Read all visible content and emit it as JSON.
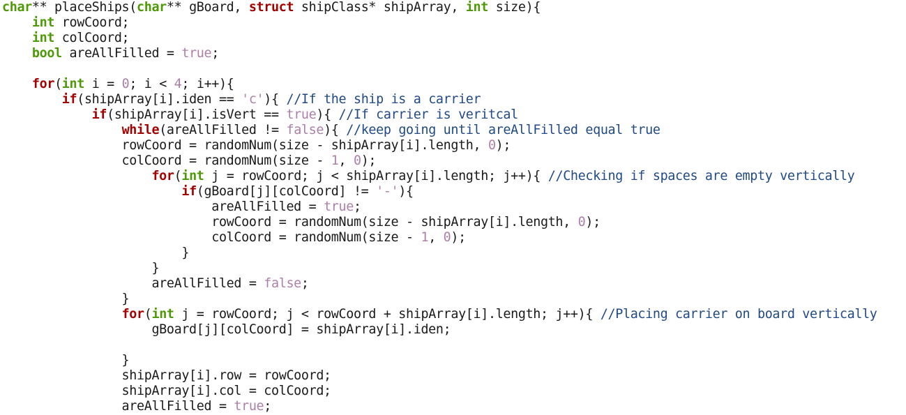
{
  "editor": {
    "lines": [
      [
        {
          "t": "type",
          "v": "char"
        },
        {
          "t": "plain",
          "v": "** placeShips("
        },
        {
          "t": "type",
          "v": "char"
        },
        {
          "t": "plain",
          "v": "** gBoard, "
        },
        {
          "t": "kw",
          "v": "struct"
        },
        {
          "t": "plain",
          "v": " shipClass* shipArray, "
        },
        {
          "t": "type",
          "v": "int"
        },
        {
          "t": "plain",
          "v": " size){"
        }
      ],
      [
        {
          "t": "plain",
          "v": "    "
        },
        {
          "t": "type",
          "v": "int"
        },
        {
          "t": "plain",
          "v": " rowCoord;"
        }
      ],
      [
        {
          "t": "plain",
          "v": "    "
        },
        {
          "t": "type",
          "v": "int"
        },
        {
          "t": "plain",
          "v": " colCoord;"
        }
      ],
      [
        {
          "t": "plain",
          "v": "    "
        },
        {
          "t": "type",
          "v": "bool"
        },
        {
          "t": "plain",
          "v": " areAllFilled = "
        },
        {
          "t": "lit",
          "v": "true"
        },
        {
          "t": "plain",
          "v": ";"
        }
      ],
      [],
      [
        {
          "t": "plain",
          "v": "    "
        },
        {
          "t": "kw",
          "v": "for"
        },
        {
          "t": "plain",
          "v": "("
        },
        {
          "t": "type",
          "v": "int"
        },
        {
          "t": "plain",
          "v": " i = "
        },
        {
          "t": "lit",
          "v": "0"
        },
        {
          "t": "plain",
          "v": "; i < "
        },
        {
          "t": "lit",
          "v": "4"
        },
        {
          "t": "plain",
          "v": "; i++){"
        }
      ],
      [
        {
          "t": "plain",
          "v": "        "
        },
        {
          "t": "kw",
          "v": "if"
        },
        {
          "t": "plain",
          "v": "(shipArray[i].iden == "
        },
        {
          "t": "lit",
          "v": "'c'"
        },
        {
          "t": "plain",
          "v": "){ "
        },
        {
          "t": "comment",
          "v": "//If the ship is a carrier"
        }
      ],
      [
        {
          "t": "plain",
          "v": "            "
        },
        {
          "t": "kw",
          "v": "if"
        },
        {
          "t": "plain",
          "v": "(shipArray[i].isVert == "
        },
        {
          "t": "lit",
          "v": "true"
        },
        {
          "t": "plain",
          "v": "){ "
        },
        {
          "t": "comment",
          "v": "//If carrier is veritcal"
        }
      ],
      [
        {
          "t": "plain",
          "v": "                "
        },
        {
          "t": "kw",
          "v": "while"
        },
        {
          "t": "plain",
          "v": "(areAllFilled != "
        },
        {
          "t": "lit",
          "v": "false"
        },
        {
          "t": "plain",
          "v": "){ "
        },
        {
          "t": "comment",
          "v": "//keep going until areAllFilled equal true"
        }
      ],
      [
        {
          "t": "plain",
          "v": "                rowCoord = randomNum(size - shipArray[i].length, "
        },
        {
          "t": "lit",
          "v": "0"
        },
        {
          "t": "plain",
          "v": ");"
        }
      ],
      [
        {
          "t": "plain",
          "v": "                colCoord = randomNum(size - "
        },
        {
          "t": "lit",
          "v": "1"
        },
        {
          "t": "plain",
          "v": ", "
        },
        {
          "t": "lit",
          "v": "0"
        },
        {
          "t": "plain",
          "v": ");"
        }
      ],
      [
        {
          "t": "plain",
          "v": "                    "
        },
        {
          "t": "kw",
          "v": "for"
        },
        {
          "t": "plain",
          "v": "("
        },
        {
          "t": "type",
          "v": "int"
        },
        {
          "t": "plain",
          "v": " j = rowCoord; j < shipArray[i].length; j++){ "
        },
        {
          "t": "comment",
          "v": "//Checking if spaces are empty vertically"
        }
      ],
      [
        {
          "t": "plain",
          "v": "                        "
        },
        {
          "t": "kw",
          "v": "if"
        },
        {
          "t": "plain",
          "v": "(gBoard[j][colCoord] != "
        },
        {
          "t": "lit",
          "v": "'-'"
        },
        {
          "t": "plain",
          "v": "){"
        }
      ],
      [
        {
          "t": "plain",
          "v": "                            areAllFilled = "
        },
        {
          "t": "lit",
          "v": "true"
        },
        {
          "t": "plain",
          "v": ";"
        }
      ],
      [
        {
          "t": "plain",
          "v": "                            rowCoord = randomNum(size - shipArray[i].length, "
        },
        {
          "t": "lit",
          "v": "0"
        },
        {
          "t": "plain",
          "v": ");"
        }
      ],
      [
        {
          "t": "plain",
          "v": "                            colCoord = randomNum(size - "
        },
        {
          "t": "lit",
          "v": "1"
        },
        {
          "t": "plain",
          "v": ", "
        },
        {
          "t": "lit",
          "v": "0"
        },
        {
          "t": "plain",
          "v": ");"
        }
      ],
      [
        {
          "t": "plain",
          "v": "                        }"
        }
      ],
      [
        {
          "t": "plain",
          "v": "                    }"
        }
      ],
      [
        {
          "t": "plain",
          "v": "                    areAllFilled = "
        },
        {
          "t": "lit",
          "v": "false"
        },
        {
          "t": "plain",
          "v": ";"
        }
      ],
      [
        {
          "t": "plain",
          "v": "                }"
        }
      ],
      [
        {
          "t": "plain",
          "v": "                "
        },
        {
          "t": "kw",
          "v": "for"
        },
        {
          "t": "plain",
          "v": "("
        },
        {
          "t": "type",
          "v": "int"
        },
        {
          "t": "plain",
          "v": " j = rowCoord; j < rowCoord + shipArray[i].length; j++){ "
        },
        {
          "t": "comment",
          "v": "//Placing carrier on board vertically"
        }
      ],
      [
        {
          "t": "plain",
          "v": "                    gBoard[j][colCoord] = shipArray[i].iden;"
        }
      ],
      [],
      [
        {
          "t": "plain",
          "v": "                }"
        }
      ],
      [
        {
          "t": "plain",
          "v": "                shipArray[i].row = rowCoord;"
        }
      ],
      [
        {
          "t": "plain",
          "v": "                shipArray[i].col = colCoord;"
        }
      ],
      [
        {
          "t": "plain",
          "v": "                areAllFilled = "
        },
        {
          "t": "lit",
          "v": "true"
        },
        {
          "t": "plain",
          "v": ";"
        }
      ]
    ]
  },
  "colors": {
    "background": "#ffffff",
    "text": "#1a1a1a",
    "type": "#4e9a06",
    "keyword": "#a40000",
    "literal": "#ad7fa8",
    "comment": "#204a87"
  }
}
